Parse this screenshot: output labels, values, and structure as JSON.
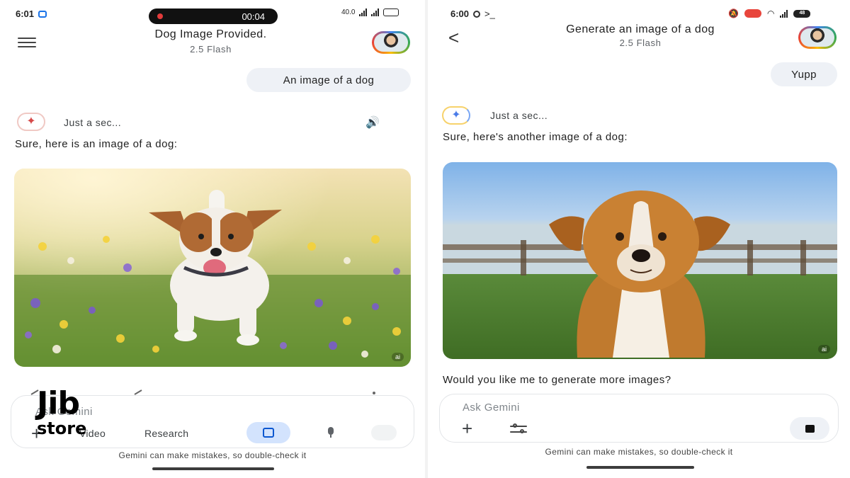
{
  "left": {
    "status": {
      "time": "6:01",
      "recording_time": "00:04",
      "network_speed": "40.0"
    },
    "header": {
      "title": "Dog Image Provided.",
      "subtitle": "2.5 Flash"
    },
    "user_message": "An image of a dog",
    "thinking_text": "Just a sec...",
    "response_text": "Sure, here is an image of a dog:",
    "image_badge": "ai",
    "input": {
      "placeholder": "Ask Gemini",
      "tools": [
        "Video",
        "Research"
      ]
    },
    "disclaimer": "Gemini can make mistakes, so double-check it",
    "watermark": {
      "line1": "Jib",
      "line2": "store"
    }
  },
  "right": {
    "status": {
      "time": "6:00",
      "battery": "48"
    },
    "header": {
      "title": "Generate an image of a dog",
      "subtitle": "2.5 Flash"
    },
    "user_message": "Yupp",
    "thinking_text": "Just a sec...",
    "response_text": "Sure, here's another image of a dog:",
    "image_badge": "ai",
    "followup_text": "Would you like me to generate more images?",
    "input": {
      "placeholder": "Ask Gemini"
    },
    "disclaimer": "Gemini can make mistakes, so double-check it"
  },
  "colors": {
    "user_bubble": "#eef1f6",
    "image_tool_active": "#d3e3fd",
    "accent_blue": "#0b57d0",
    "recording_red": "#e23b3b"
  },
  "icons": [
    "menu-icon",
    "back-icon",
    "gemini-spark-icon",
    "speaker-icon",
    "plus-icon",
    "image-tool-icon",
    "mic-icon",
    "send-icon",
    "tools-sliders-icon",
    "stop-icon"
  ]
}
